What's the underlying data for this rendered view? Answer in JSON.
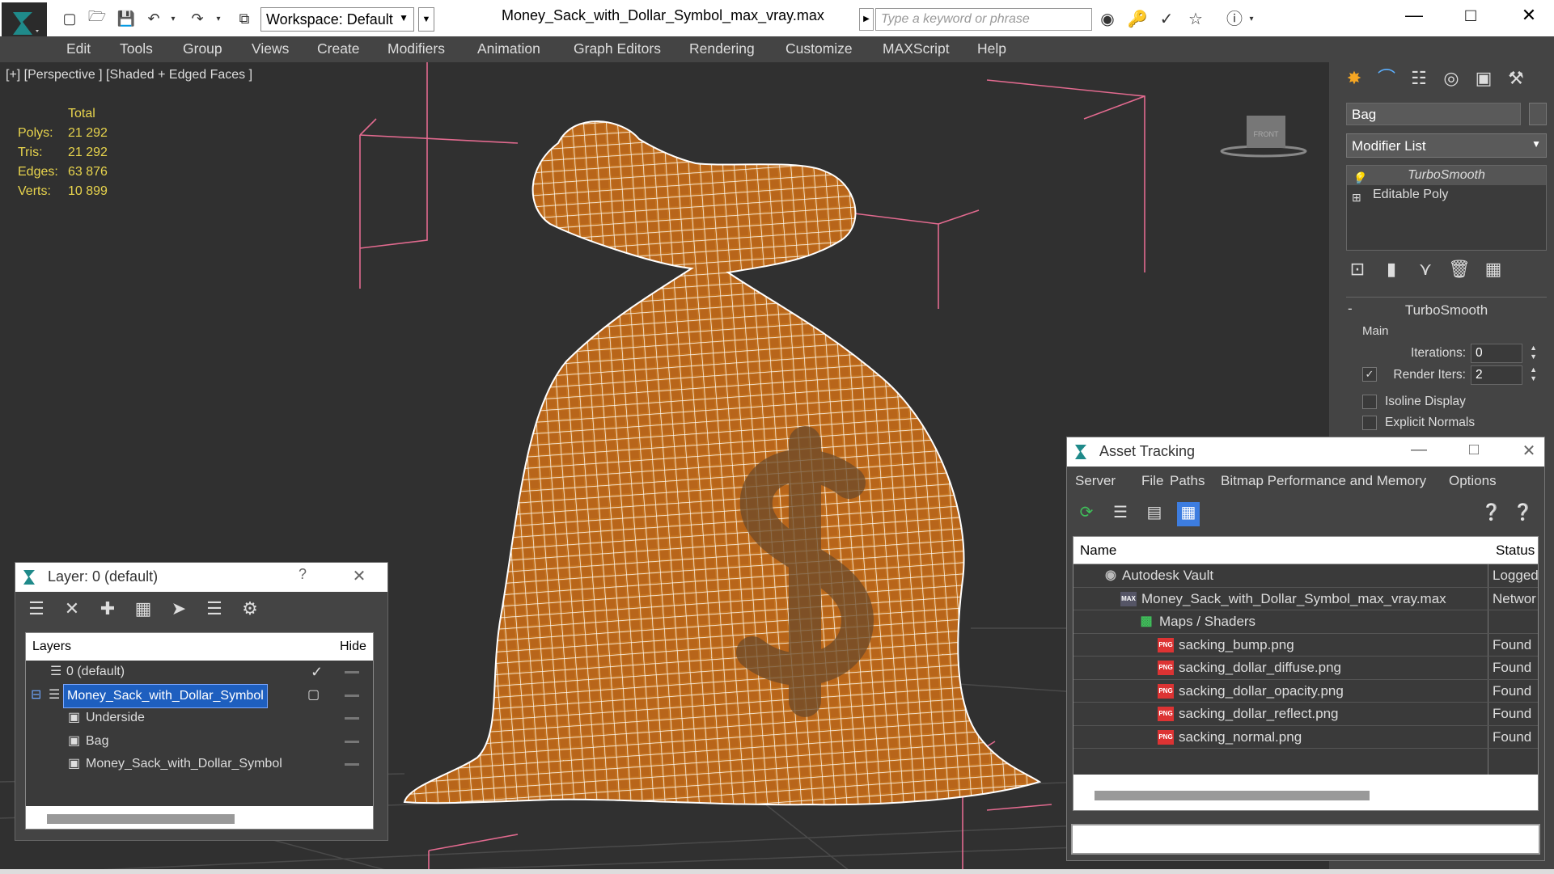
{
  "titlebar": {
    "workspace_label": "Workspace: Default",
    "file_title": "Money_Sack_with_Dollar_Symbol_max_vray.max",
    "search_placeholder": "Type a keyword or phrase"
  },
  "menu": [
    "Edit",
    "Tools",
    "Group",
    "Views",
    "Create",
    "Modifiers",
    "Animation",
    "Graph Editors",
    "Rendering",
    "Customize",
    "MAXScript",
    "Help"
  ],
  "viewport": {
    "label": "[+] [Perspective ] [Shaded + Edged Faces ]",
    "stats_header": "Total",
    "stats": [
      {
        "key": "Polys:",
        "value": "21 292"
      },
      {
        "key": "Tris:",
        "value": "21 292"
      },
      {
        "key": "Edges:",
        "value": "63 876"
      },
      {
        "key": "Verts:",
        "value": "10 899"
      }
    ],
    "viewcube_label": "FRONT",
    "colors": {
      "background": "#303030",
      "stats": "#e8d44d",
      "mesh": "#c8741f",
      "wire": "#ffffff",
      "bbox": "#e26a8f",
      "grid": "#4a4a4a"
    }
  },
  "command_panel": {
    "object_name": "Bag",
    "modifier_list_label": "Modifier List",
    "stack": [
      "TurboSmooth",
      "Editable Poly"
    ],
    "rollout_title": "TurboSmooth",
    "group_main": "Main",
    "iterations_label": "Iterations:",
    "iterations_value": "0",
    "render_iters_label": "Render Iters:",
    "render_iters_value": "2",
    "isoline_label": "Isoline Display",
    "explicit_label": "Explicit Normals"
  },
  "layer_panel": {
    "title": "Layer: 0 (default)",
    "col_layers": "Layers",
    "col_hide": "Hide",
    "rows": [
      {
        "name": "0 (default)",
        "indent": 1
      },
      {
        "name": "Money_Sack_with_Dollar_Symbol",
        "indent": 1,
        "selected": true
      },
      {
        "name": "Underside",
        "indent": 2
      },
      {
        "name": "Bag",
        "indent": 2
      },
      {
        "name": "Money_Sack_with_Dollar_Symbol",
        "indent": 2
      }
    ]
  },
  "asset_panel": {
    "title": "Asset Tracking",
    "menu": [
      "Server",
      "File",
      "Paths",
      "Bitmap Performance and Memory",
      "Options"
    ],
    "col_name": "Name",
    "col_status": "Status",
    "rows": [
      {
        "name": "Autodesk Vault",
        "status": "Logged",
        "indent": 1
      },
      {
        "name": "Money_Sack_with_Dollar_Symbol_max_vray.max",
        "status": "Networ",
        "indent": 2
      },
      {
        "name": "Maps / Shaders",
        "status": "",
        "indent": 3
      },
      {
        "name": "sacking_bump.png",
        "status": "Found",
        "indent": 4
      },
      {
        "name": "sacking_dollar_diffuse.png",
        "status": "Found",
        "indent": 4
      },
      {
        "name": "sacking_dollar_opacity.png",
        "status": "Found",
        "indent": 4
      },
      {
        "name": "sacking_dollar_reflect.png",
        "status": "Found",
        "indent": 4
      },
      {
        "name": "sacking_normal.png",
        "status": "Found",
        "indent": 4
      }
    ]
  }
}
